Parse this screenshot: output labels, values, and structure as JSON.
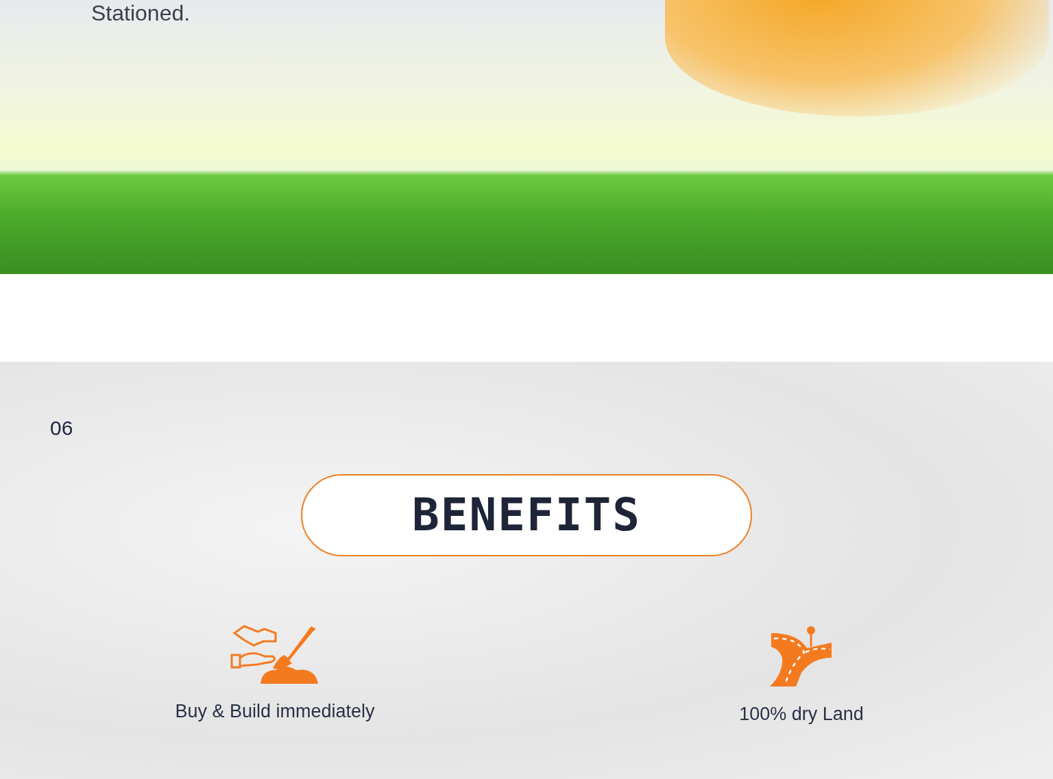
{
  "hero": {
    "text": "Stationed."
  },
  "section": {
    "number": "06",
    "title": "BENEFITS",
    "benefits": [
      {
        "label": "Buy & Build immediately"
      },
      {
        "label": "100% dry Land"
      }
    ]
  }
}
